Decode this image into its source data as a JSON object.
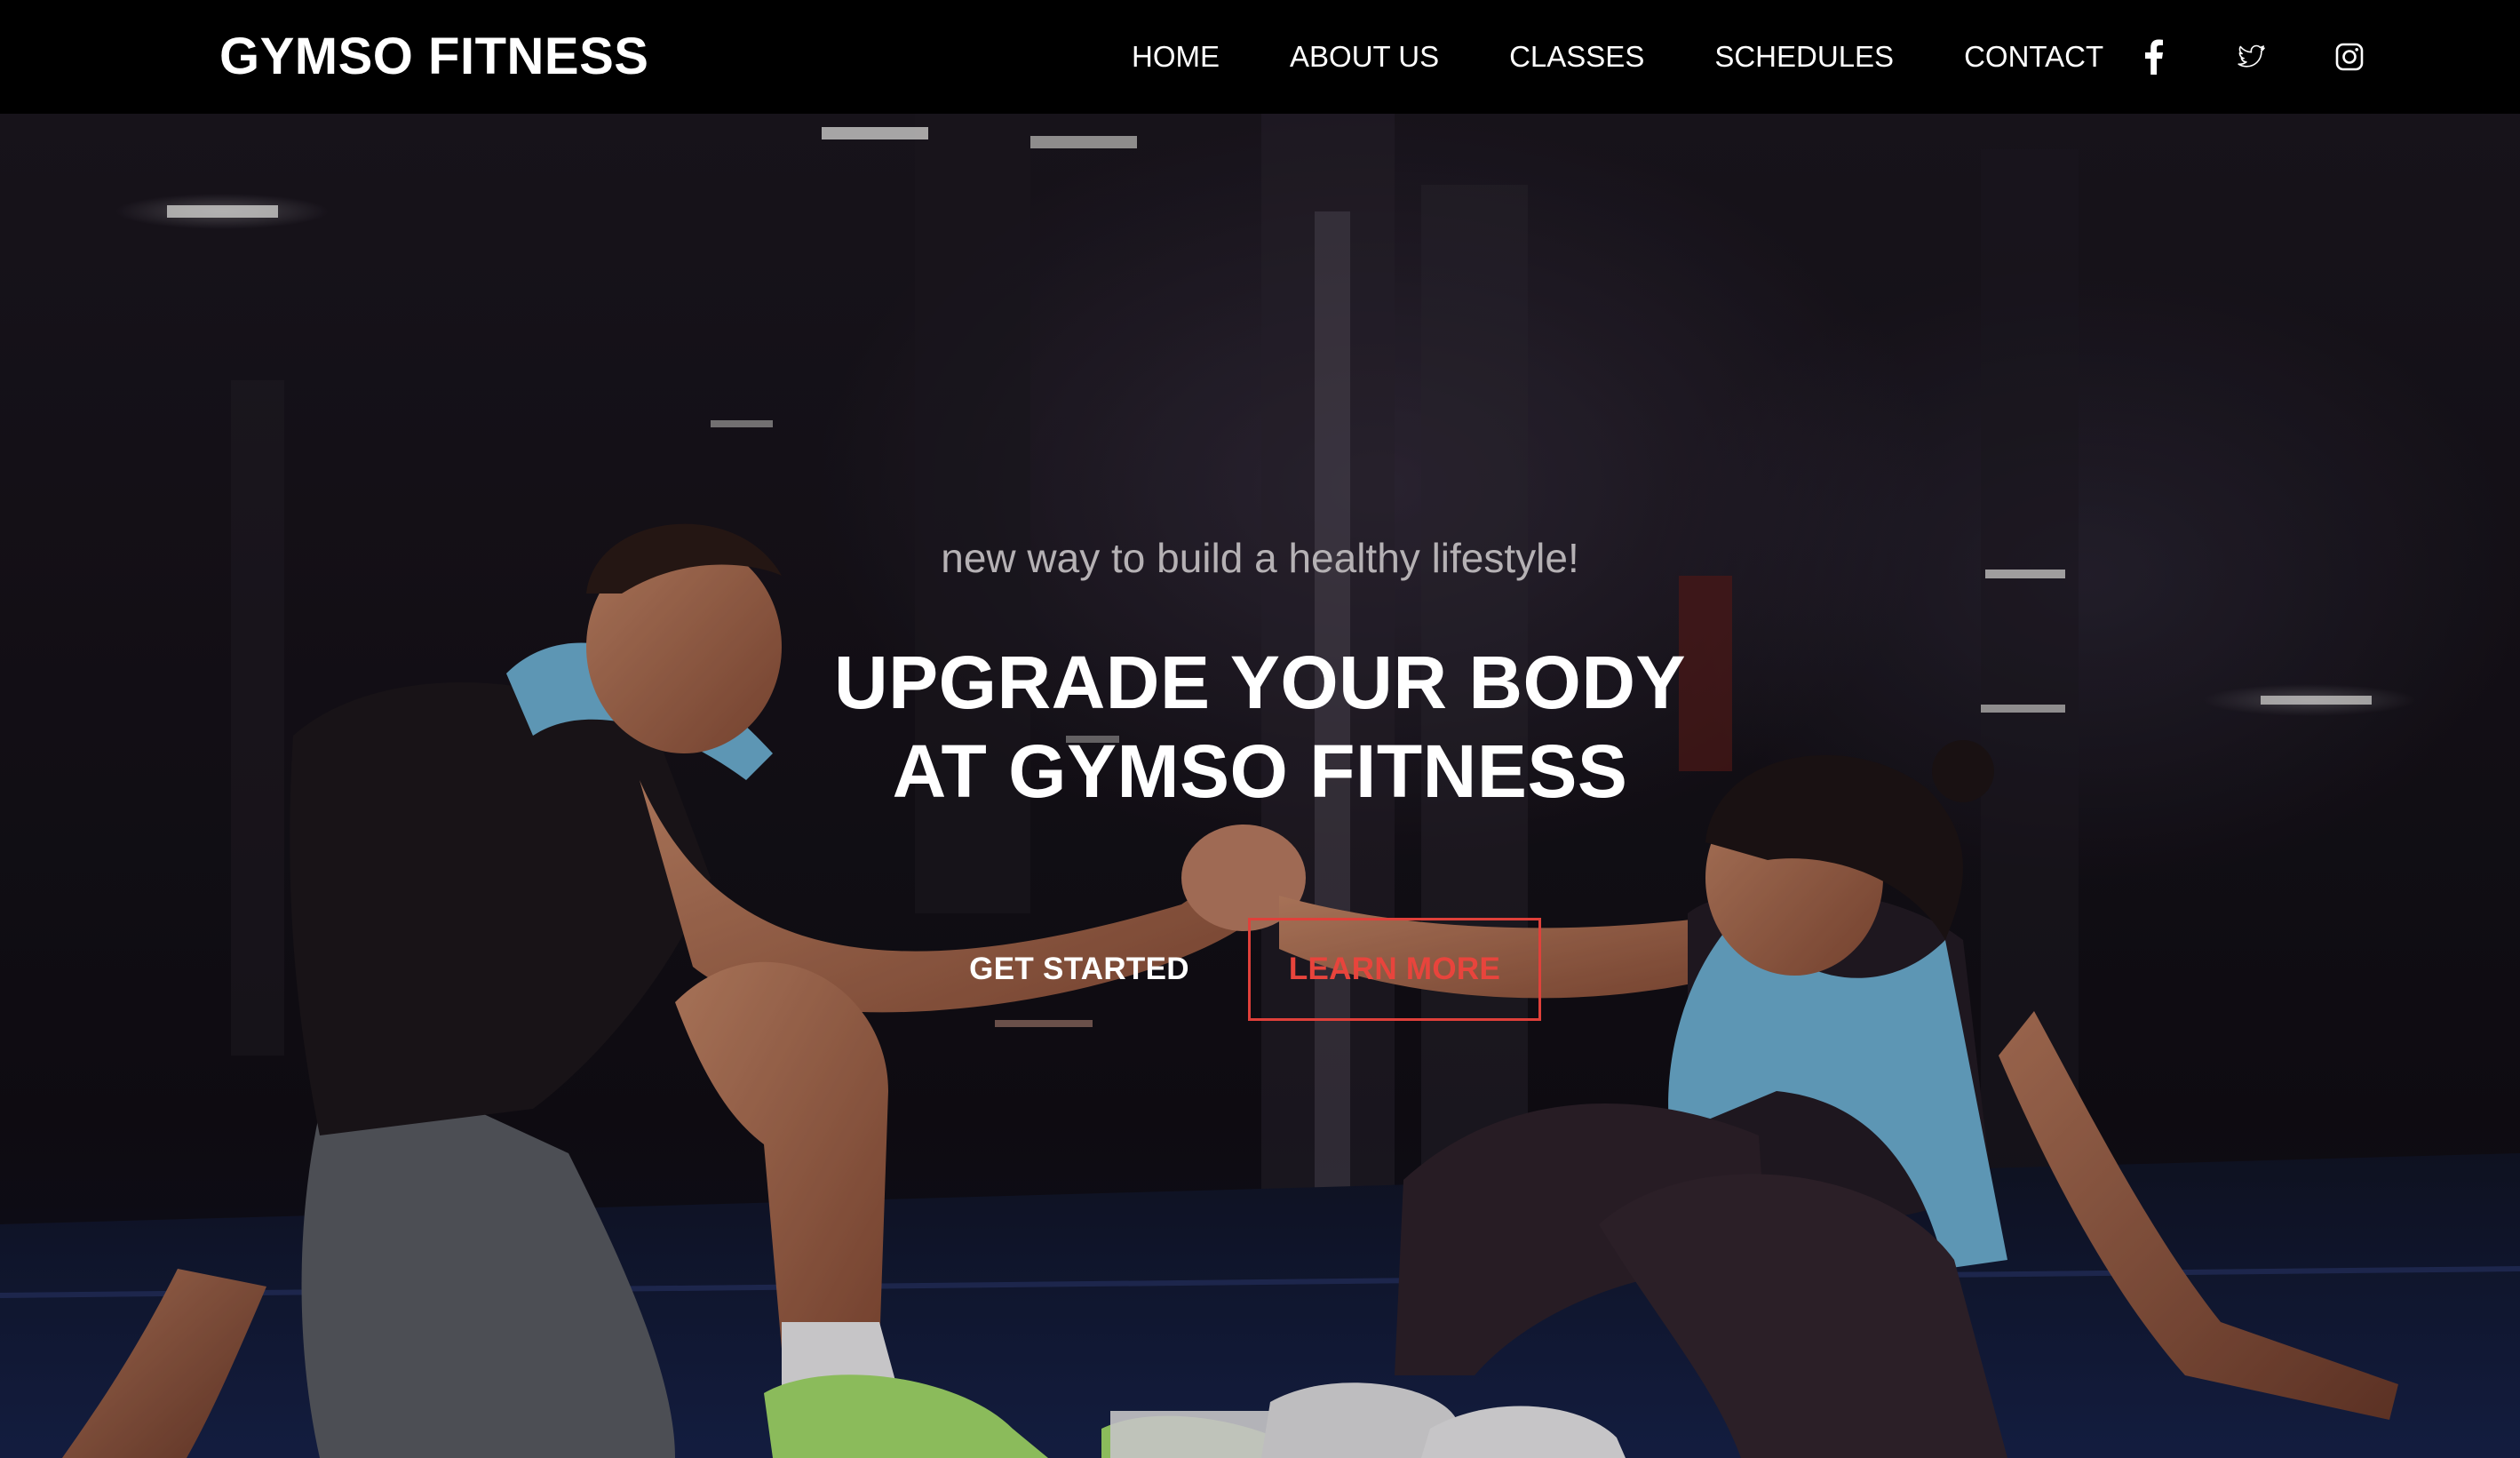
{
  "navbar": {
    "brand": "GYMSO FITNESS",
    "links": [
      {
        "label": "HOME"
      },
      {
        "label": "ABOUT US"
      },
      {
        "label": "CLASSES"
      },
      {
        "label": "SCHEDULES"
      },
      {
        "label": "CONTACT"
      }
    ],
    "social": [
      {
        "icon": "facebook-icon"
      },
      {
        "icon": "twitter-icon"
      },
      {
        "icon": "instagram-icon"
      }
    ]
  },
  "hero": {
    "tagline": "new way to build a healthy lifestyle!",
    "headline_line1": "UPGRADE YOUR BODY",
    "headline_line2": "AT GYMSO FITNESS",
    "primary_button": "GET STARTED",
    "secondary_button": "LEARN MORE",
    "image": "photo of a man and woman sitting on a gym floor clasping hands"
  },
  "colors": {
    "navbar_bg": "#000000",
    "accent": "#e8443c",
    "text_light": "#ffffff",
    "tagline": "#b5b1b4"
  }
}
